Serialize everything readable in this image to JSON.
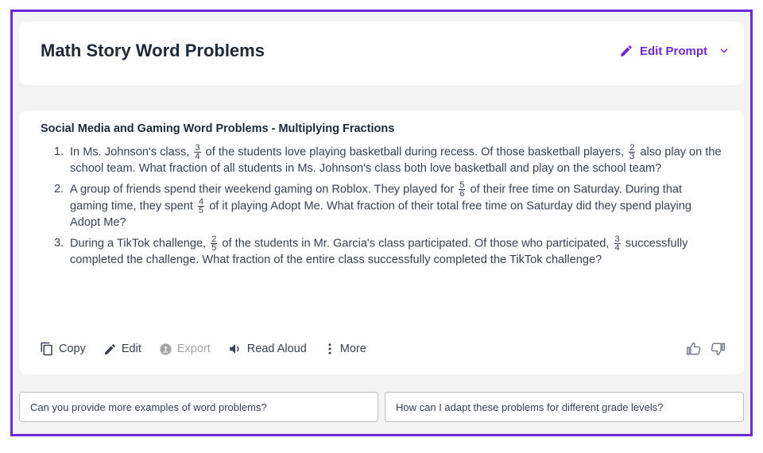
{
  "header": {
    "title": "Math Story Word Problems",
    "edit_prompt_label": "Edit Prompt"
  },
  "content": {
    "section_title": "Social Media and Gaming Word Problems - Multiplying Fractions",
    "problems": [
      {
        "number": "1.",
        "p1": "In Ms. Johnson's class,",
        "f1": {
          "n": "3",
          "d": "4"
        },
        "p2": "of the students love playing basketball during recess. Of those basketball players,",
        "f2": {
          "n": "2",
          "d": "3"
        },
        "p3": "also play on the school team. What fraction of all students in Ms. Johnson's class both love basketball and play on the school team?"
      },
      {
        "number": "2.",
        "p1": "A group of friends spend their weekend gaming on Roblox. They played for",
        "f1": {
          "n": "5",
          "d": "6"
        },
        "p2": "of their free time on Saturday. During that gaming time, they spent",
        "f2": {
          "n": "4",
          "d": "5"
        },
        "p3": "of it playing Adopt Me. What fraction of their total free time on Saturday did they spend playing Adopt Me?"
      },
      {
        "number": "3.",
        "p1": "During a TikTok challenge,",
        "f1": {
          "n": "2",
          "d": "5"
        },
        "p2": "of the students in Mr. Garcia's class participated. Of those who participated,",
        "f2": {
          "n": "3",
          "d": "4"
        },
        "p3": "successfully completed the challenge. What fraction of the entire class successfully completed the TikTok challenge?"
      }
    ]
  },
  "toolbar": {
    "copy_label": "Copy",
    "edit_label": "Edit",
    "export_label": "Export",
    "read_aloud_label": "Read Aloud",
    "more_label": "More"
  },
  "suggestions": [
    "Can you provide more examples of word problems?",
    "How can I adapt these problems for different grade levels?"
  ],
  "colors": {
    "accent": "#6d28d9",
    "frame_border": "#6d28d9",
    "background": "#f3f3f4",
    "disabled_text": "#a3a3a3"
  },
  "icons": {
    "edit_prompt": "pencil-icon",
    "dropdown": "chevron-down-icon",
    "copy": "copy-icon",
    "edit": "pencil-icon",
    "export": "export-icon",
    "read_aloud": "speaker-icon",
    "more": "more-vertical-icon",
    "like": "thumbs-up-icon",
    "dislike": "thumbs-down-icon"
  }
}
